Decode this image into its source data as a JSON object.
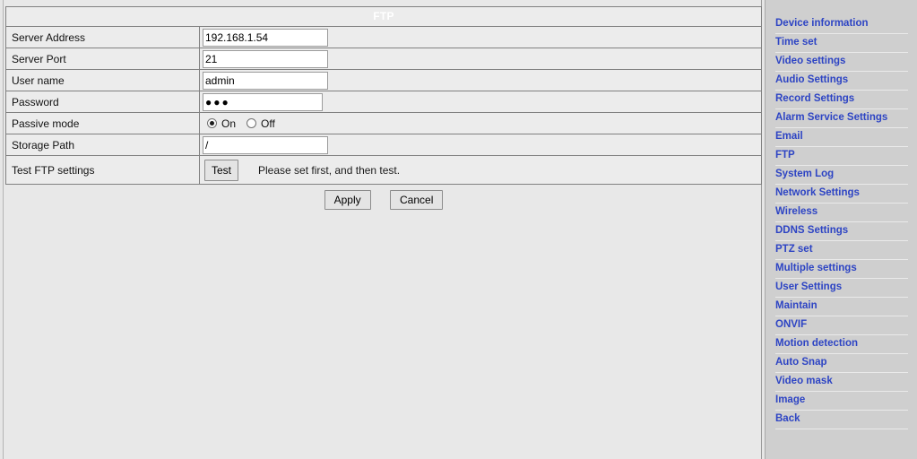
{
  "page": {
    "title": "FTP"
  },
  "form": {
    "rows": [
      {
        "label": "Server Address",
        "type": "text",
        "value": "192.168.1.54"
      },
      {
        "label": "Server Port",
        "type": "text",
        "value": "21"
      },
      {
        "label": "User name",
        "type": "text",
        "value": "admin"
      },
      {
        "label": "Password",
        "type": "password",
        "value": "●●●"
      },
      {
        "label": "Passive mode",
        "type": "radio"
      },
      {
        "label": "Storage Path",
        "type": "text",
        "value": "/"
      },
      {
        "label": "Test FTP settings",
        "type": "test"
      }
    ],
    "labels": {
      "server_address": "Server Address",
      "server_port": "Server Port",
      "user_name": "User name",
      "password": "Password",
      "passive_mode": "Passive mode",
      "storage_path": "Storage Path",
      "test_ftp_settings": "Test FTP settings"
    },
    "values": {
      "server_address": "192.168.1.54",
      "server_port": "21",
      "user_name": "admin",
      "password": "●●●",
      "storage_path": "/"
    },
    "passive_mode": {
      "on_label": "On",
      "off_label": "Off",
      "selected": "On"
    },
    "test": {
      "button_label": "Test",
      "note": "Please set first, and then test."
    },
    "buttons": {
      "apply": "Apply",
      "cancel": "Cancel"
    }
  },
  "sidebar": {
    "items": [
      {
        "label": "Device information"
      },
      {
        "label": "Time set"
      },
      {
        "label": "Video settings"
      },
      {
        "label": "Audio Settings"
      },
      {
        "label": "Record Settings"
      },
      {
        "label": "Alarm Service Settings"
      },
      {
        "label": "Email"
      },
      {
        "label": "FTP"
      },
      {
        "label": "System Log"
      },
      {
        "label": "Network Settings"
      },
      {
        "label": "Wireless"
      },
      {
        "label": "DDNS Settings"
      },
      {
        "label": "PTZ set"
      },
      {
        "label": "Multiple settings"
      },
      {
        "label": "User Settings"
      },
      {
        "label": "Maintain"
      },
      {
        "label": "ONVIF"
      },
      {
        "label": "Motion detection"
      },
      {
        "label": "Auto Snap"
      },
      {
        "label": "Video mask"
      },
      {
        "label": "Image"
      },
      {
        "label": "Back"
      }
    ]
  },
  "colors": {
    "title_bar": "#0f5085",
    "link": "#2d44c4",
    "page_bg": "#e6e6e6",
    "sidebar_bg": "#cfcfcf",
    "field_bg": "#ececec"
  }
}
